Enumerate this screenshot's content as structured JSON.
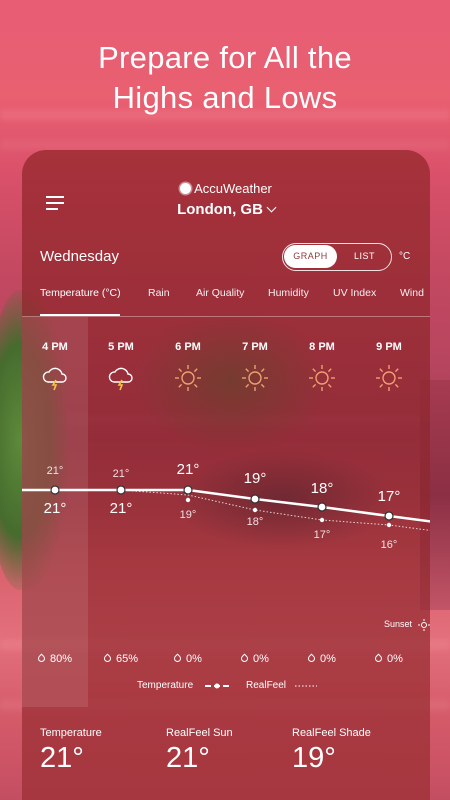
{
  "headline": {
    "line1": "Prepare for All the",
    "line2": "Highs and Lows"
  },
  "app": {
    "brand": "AccuWeather",
    "location": "London, GB"
  },
  "forecast": {
    "day": "Wednesday",
    "view_toggle": {
      "graph": "GRAPH",
      "list": "LIST",
      "selected": "GRAPH"
    },
    "unit": "°C",
    "tabs": [
      "Temperature (°C)",
      "Rain",
      "Air Quality",
      "Humidity",
      "UV Index",
      "Wind"
    ],
    "active_tab": "Temperature (°C)",
    "hours": [
      {
        "time": "4 PM",
        "icon": "thunderstorm-icon",
        "temp": "21°",
        "realfeel": "21°",
        "precip": "80%"
      },
      {
        "time": "5 PM",
        "icon": "thunderstorm-icon",
        "temp": "21°",
        "realfeel": "21°",
        "precip": "65%"
      },
      {
        "time": "6 PM",
        "icon": "sun-icon",
        "temp": "21°",
        "realfeel": "19°",
        "precip": "0%"
      },
      {
        "time": "7 PM",
        "icon": "sun-icon",
        "temp": "19°",
        "realfeel": "18°",
        "precip": "0%"
      },
      {
        "time": "8 PM",
        "icon": "sun-icon",
        "temp": "18°",
        "realfeel": "17°",
        "precip": "0%"
      },
      {
        "time": "9 PM",
        "icon": "sun-icon",
        "temp": "17°",
        "realfeel": "16°",
        "precip": "0%"
      }
    ],
    "sunset_label": "Sunset",
    "legend": {
      "temperature": "Temperature",
      "realfeel": "RealFeel"
    },
    "summary": [
      {
        "label": "Temperature",
        "value": "21°"
      },
      {
        "label": "RealFeel Sun",
        "value": "21°"
      },
      {
        "label": "RealFeel Shade",
        "value": "19°"
      }
    ]
  },
  "colors": {
    "card_bg": "#962d33",
    "accent_sun": "#f0a070",
    "toggle_text": "#8e3a40"
  }
}
